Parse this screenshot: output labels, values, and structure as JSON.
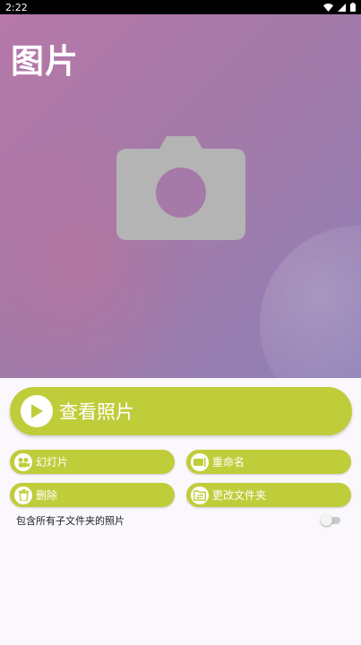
{
  "status_bar": {
    "time": "2:22"
  },
  "hero": {
    "title": "图片",
    "placeholder_icon": "camera-icon"
  },
  "actions": {
    "view_photos": {
      "label": "查看照片",
      "icon": "play-icon"
    },
    "slideshow": {
      "label": "幻灯片",
      "icon": "slideshow-icon"
    },
    "rename": {
      "label": "重命名",
      "icon": "rename-icon"
    },
    "delete": {
      "label": "删除",
      "icon": "trash-icon"
    },
    "change_folder": {
      "label": "更改文件夹",
      "icon": "folder-swap-icon"
    }
  },
  "options": {
    "include_subfolders": {
      "label": "包含所有子文件夹的照片",
      "enabled": false
    }
  },
  "colors": {
    "accent": "#c0cd3b",
    "hero_start": "#b678a8",
    "hero_end": "#8f80b7",
    "panel_background": "#fbf8fd"
  }
}
